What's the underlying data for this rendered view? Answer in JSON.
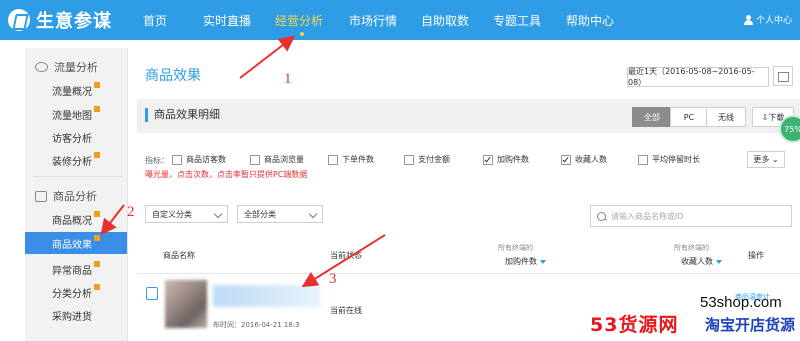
{
  "app": {
    "logo_text": "生意参谋"
  },
  "nav": {
    "items": [
      "首页",
      "实时直播",
      "经营分析",
      "市场行情",
      "自助取数",
      "专题工具",
      "帮助中心"
    ],
    "active_index": 2,
    "user_label": "个人中心"
  },
  "sidebar": {
    "section1_title": "流量分析",
    "section1_items": [
      "流量概况",
      "流量地图",
      "访客分析",
      "装修分析"
    ],
    "section2_title": "商品分析",
    "section2_items": [
      "商品概况",
      "商品效果",
      "异常商品",
      "分类分析",
      "采购进货"
    ],
    "active_item": "商品效果"
  },
  "main": {
    "title": "商品效果",
    "date_range": "最近1天（2016-05-08~2016-05-08）",
    "detail_title": "商品效果明细",
    "tabs": [
      "全部",
      "PC",
      "无线"
    ],
    "download_label": "下载",
    "percent_badge": "75%"
  },
  "metrics": {
    "label": "指标：",
    "options": [
      {
        "label": "商品访客数",
        "checked": false
      },
      {
        "label": "商品浏览量",
        "checked": false
      },
      {
        "label": "下单件数",
        "checked": false
      },
      {
        "label": "支付金额",
        "checked": false
      },
      {
        "label": "加购件数",
        "checked": true
      },
      {
        "label": "收藏人数",
        "checked": true
      },
      {
        "label": "平均停留时长",
        "checked": false
      }
    ],
    "more_label": "更多",
    "warning": "曝光量，点击次数，点击率暂只提供PC端数据"
  },
  "filters": {
    "category1": "自定义分类",
    "category2": "全部分类",
    "search_placeholder": "请输入商品名称或ID"
  },
  "table": {
    "col_name": "商品名称",
    "col_status": "当前状态",
    "col_cart_sub": "所有终端的",
    "col_cart": "加购件数",
    "col_fav_sub": "所有终端的",
    "col_fav": "收藏人数",
    "col_op": "操作",
    "row": {
      "pub_time": "布时间：2016-04-21 18:3",
      "status": "当前在线",
      "op1": "商品温度计",
      "op2": "..."
    }
  },
  "annotations": [
    "1",
    "2",
    "3"
  ],
  "watermark": {
    "url": "53shop.com",
    "brand_red": "53货源网",
    "brand_blue": "淘宝开店货源"
  }
}
